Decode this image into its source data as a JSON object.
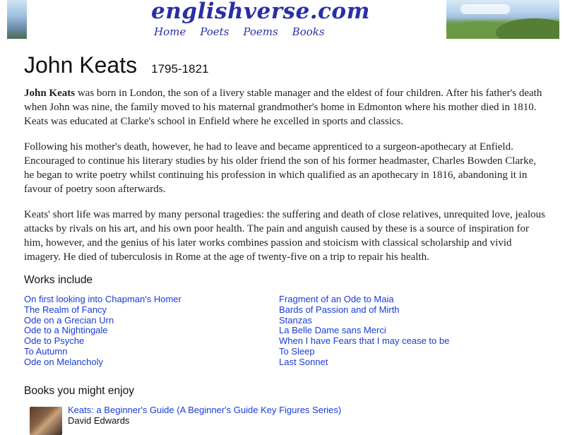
{
  "site": {
    "logo": "englishverse.com",
    "nav": [
      "Home",
      "Poets",
      "Poems",
      "Books"
    ]
  },
  "poet": {
    "name": "John Keats",
    "dates": "1795-1821"
  },
  "bio": {
    "p1_name": "John Keats",
    "p1_rest": " was born in London, the son of a livery stable manager and the eldest of four children. After his father's death when John was nine, the family moved to his maternal grandmother's home in Edmonton where his mother died in 1810. Keats was educated at Clarke's school in Enfield where he excelled in sports and classics.",
    "p2": "Following his mother's death, however, he had to leave and became apprenticed to a surgeon-apothecary at Enfield. Encouraged to continue his literary studies by his older friend the son of his former headmaster, Charles Bowden Clarke, he began to write poetry whilst continuing his profession in which qualified as an apothecary in 1816, abandoning it in favour of poetry soon afterwards.",
    "p3": "Keats' short life was marred by many personal tragedies: the suffering and death of close relatives, unrequited love, jealous attacks by rivals on his art, and his own poor health. The pain and anguish caused by these is a source of inspiration for him, however, and the genius of his later works combines passion and stoicism with classical scholarship and vivid imagery. He died of tuberculosis in Rome at the age of twenty-five on a trip to repair his health."
  },
  "works": {
    "heading": "Works include",
    "col1": [
      "On first looking into Chapman's Homer",
      "The Realm of Fancy",
      "Ode on a Grecian Urn",
      "Ode to a Nightingale",
      "Ode to Psyche",
      "To Autumn",
      "Ode on Melancholy"
    ],
    "col2": [
      "Fragment of an Ode to Maia",
      "Bards of Passion and of Mirth",
      "Stanzas",
      "La Belle Dame sans Merci",
      "When I have Fears that I may cease to be",
      "To Sleep",
      "Last Sonnet"
    ]
  },
  "books": {
    "heading": "Books you might enjoy",
    "items": [
      {
        "title": "Keats: a Beginner's Guide (A Beginner's Guide Key Figures Series)",
        "author": "David Edwards"
      }
    ]
  }
}
